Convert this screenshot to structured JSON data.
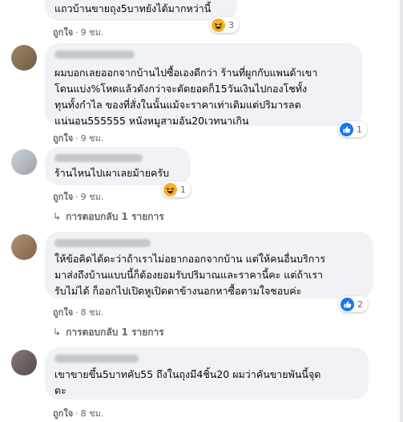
{
  "comments": [
    {
      "text": "แถวบ้านขายถุง5บาทยังได้มากหว่านี้",
      "like_label": "ถูกใจ",
      "time": "9 ชม.",
      "reaction": "haha",
      "reaction_count": "3"
    },
    {
      "text": "ผมบอกเลยออกจากบ้านไปซื้อเองดีกว่า ร้านที่ผูกกับแพนด้าเขา\nโดนแบ่ง%โหดแล้วดังกว่าจะดัดยอดก็15วันเงินไปกองโชทั้ง\nทุนทั้งกำไล ของที่สั่งในนั้นแม้จะราคาเท่าเดิมแต่ปริมารลด\nแน่นอน555555 หนังหมูสามอัน20เวทนาเกิน",
      "like_label": "ถูกใจ",
      "time": "9 ชม.",
      "reaction": "like",
      "reaction_count": "1"
    },
    {
      "text": "ร้านไหนไปเผาเลยม้ายครับ",
      "like_label": "ถูกใจ",
      "time": "9 ชม.",
      "reaction": "haha",
      "reaction_count": "1",
      "replies": "การตอบกลับ 1 รายการ"
    },
    {
      "text": "ให้ข้อคิดได้ดะว่าถ้าเราไม่อยากออกจากบ้าน แต่ให้คนอื่นบริการ\nมาส่งถึงบ้านแบบนี้ก็ต้องยอมรับปริมาณและราคานี้คะ แต่ถ้าเรา\nรับไม่ได้ ก็ออกไปเปิดหูเปิดตาข้างนอกหาซื้อตามใจชอบค่ะ",
      "like_label": "ถูกใจ",
      "time": "8 ชม.",
      "reaction": "like",
      "reaction_count": "2",
      "replies": "การตอบกลับ 1 รายการ"
    },
    {
      "text": "เขาขายขึ้น5บาทคับ55 ถึงในถุงมี4ชิ้น20 ผมว่าคันขายพันนี้จุด\nตะ",
      "like_label": "ถูกใจ",
      "time": "8 ชม."
    }
  ],
  "colors": {
    "bubble": "#f0f2f5",
    "meta_text": "#65676b",
    "like_blue": "#1877f2",
    "haha_yellow": "#f7b125"
  },
  "icons": {
    "haha": "haha-reaction-icon",
    "like": "like-reaction-icon",
    "reply_arrow": "reply-arrow-icon"
  }
}
